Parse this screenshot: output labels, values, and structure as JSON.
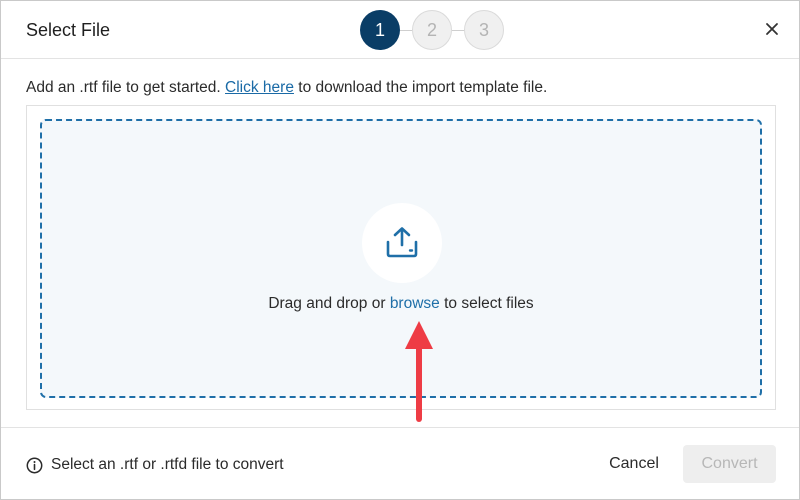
{
  "dialog": {
    "title": "Select File",
    "close_icon": "close-icon"
  },
  "stepper": {
    "steps": [
      {
        "label": "1",
        "state": "active"
      },
      {
        "label": "2",
        "state": "inactive"
      },
      {
        "label": "3",
        "state": "inactive"
      }
    ],
    "active_color": "#0a3d66"
  },
  "intro": {
    "prefix": "Add an .rtf file to get started. ",
    "link": "Click here",
    "suffix": " to download the import template file."
  },
  "dropzone": {
    "icon": "upload-icon",
    "text_prefix": "Drag and drop or ",
    "browse_link": "browse",
    "text_suffix": " to select files",
    "border_color": "#1f6fa8",
    "background": "#f4f8fb"
  },
  "annotation": {
    "arrow_color": "#ee3c45"
  },
  "footer": {
    "hint_icon": "info-icon",
    "hint": "Select an .rtf or .rtfd file to convert",
    "cancel_label": "Cancel",
    "convert_label": "Convert"
  }
}
